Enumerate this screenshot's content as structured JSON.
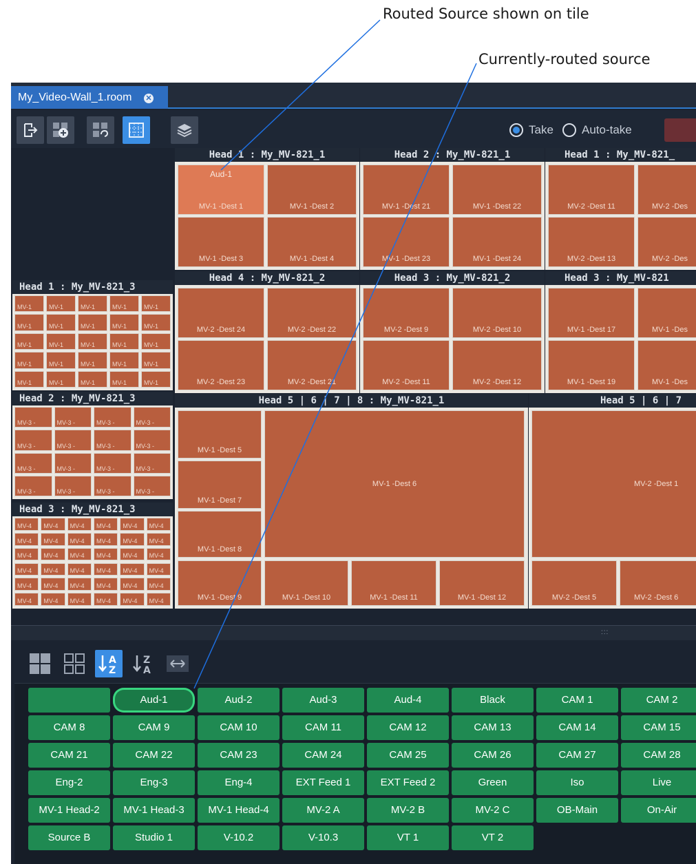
{
  "annotations": {
    "routed_source": "Routed Source shown on tile",
    "currently_routed": "Currently-routed source"
  },
  "tab": {
    "title": "My_Video-Wall_1.room",
    "close_icon": "close-icon"
  },
  "toolbar": {
    "buttons": [
      "exit-icon",
      "add-tile-icon",
      "link-icon",
      "grid-icon",
      "layers-icon"
    ],
    "take_label": "Take",
    "auto_take_label": "Auto-take",
    "take_mode": "Take"
  },
  "wall": {
    "mv_top_1": {
      "head": "Head 1 : My_MV-821_1",
      "routed_source": "Aud-1",
      "tiles": [
        "MV-1 -Dest 1",
        "MV-1 -Dest 2",
        "MV-1 -Dest 3",
        "MV-1 -Dest 4"
      ]
    },
    "mv_top_2": {
      "head": "Head 2 : My_MV-821_1",
      "tiles": [
        "MV-1 -Dest 21",
        "MV-1 -Dest 22",
        "MV-1 -Dest 23",
        "MV-1 -Dest 24"
      ]
    },
    "mv_top_3": {
      "head": "Head 1 : My_MV-821_",
      "tiles": [
        "MV-2 -Dest 11",
        "MV-2 -Des",
        "MV-2 -Dest 13",
        "MV-2 -Des"
      ]
    },
    "mv_mid_1": {
      "head": "Head 4 : My_MV-821_2",
      "tiles": [
        "MV-2 -Dest 24",
        "MV-2 -Dest 22",
        "MV-2 -Dest 23",
        "MV-2 -Dest 21"
      ]
    },
    "mv_mid_2": {
      "head": "Head 3 : My_MV-821_2",
      "tiles": [
        "MV-2 -Dest 9",
        "MV-2 -Dest 10",
        "MV-2 -Dest 11",
        "MV-2 -Dest 12"
      ]
    },
    "mv_mid_3": {
      "head": "Head 3 : My_MV-821",
      "tiles": [
        "MV-1 -Dest 17",
        "MV-1 -Des",
        "MV-1 -Dest 19",
        "MV-1 -Des"
      ]
    },
    "mv_big_1": {
      "head": "Head 5 | 6 | 7 | 8 : My_MV-821_1",
      "left_tiles": [
        "MV-1 -Dest 5",
        "MV-1 -Dest 7",
        "MV-1 -Dest 8"
      ],
      "big_tile": "MV-1 -Dest 6",
      "bottom_tiles": [
        "MV-1 -Dest 9",
        "MV-1 -Dest 10",
        "MV-1 -Dest 11",
        "MV-1 -Dest 12"
      ]
    },
    "mv_big_2": {
      "head": "Head 5 | 6 | 7",
      "big_tile": "MV-2 -Dest 1",
      "bottom_tiles": [
        "MV-2 -Dest 5",
        "MV-2 -Dest 6"
      ]
    },
    "mv_side_1": {
      "head": "Head 1 : My_MV-821_3",
      "mini_label": "MV-1"
    },
    "mv_side_2": {
      "head": "Head 2 : My_MV-821_3",
      "mini_label": "MV-3 -"
    },
    "mv_side_3": {
      "head": "Head 3 : My_MV-821_3",
      "mini_label": "MV-4"
    }
  },
  "source_toolbar": {
    "buttons": [
      "large-tiles-icon",
      "small-tiles-icon",
      "sort-a-z-icon",
      "sort-z-a-icon",
      "expand-icon"
    ],
    "active": "sort-a-z-icon"
  },
  "sources": [
    "",
    "Aud-1",
    "Aud-2",
    "Aud-3",
    "Aud-4",
    "Black",
    "CAM 1",
    "CAM 2",
    "CAM 8",
    "CAM 9",
    "CAM 10",
    "CAM 11",
    "CAM 12",
    "CAM 13",
    "CAM 14",
    "CAM 15",
    "CAM 21",
    "CAM 22",
    "CAM 23",
    "CAM 24",
    "CAM 25",
    "CAM 26",
    "CAM 27",
    "CAM 28",
    "Eng-2",
    "Eng-3",
    "Eng-4",
    "EXT Feed 1",
    "EXT Feed 2",
    "Green",
    "Iso",
    "Live",
    "MV-1 Head-2",
    "MV-1 Head-3",
    "MV-1 Head-4",
    "MV-2 A",
    "MV-2 B",
    "MV-2 C",
    "OB-Main",
    "On-Air",
    "Source B",
    "Studio 1",
    "V-10.2",
    "V-10.3",
    "VT 1",
    "VT 2"
  ],
  "selected_source": "Aud-1",
  "colors": {
    "accent": "#3b8ee4",
    "tile": "#b85e3e",
    "tile_highlight": "#de7a55",
    "source_button": "#1f8a52",
    "selected_outline": "#38d57f",
    "callout_line": "#1e6fe0"
  }
}
